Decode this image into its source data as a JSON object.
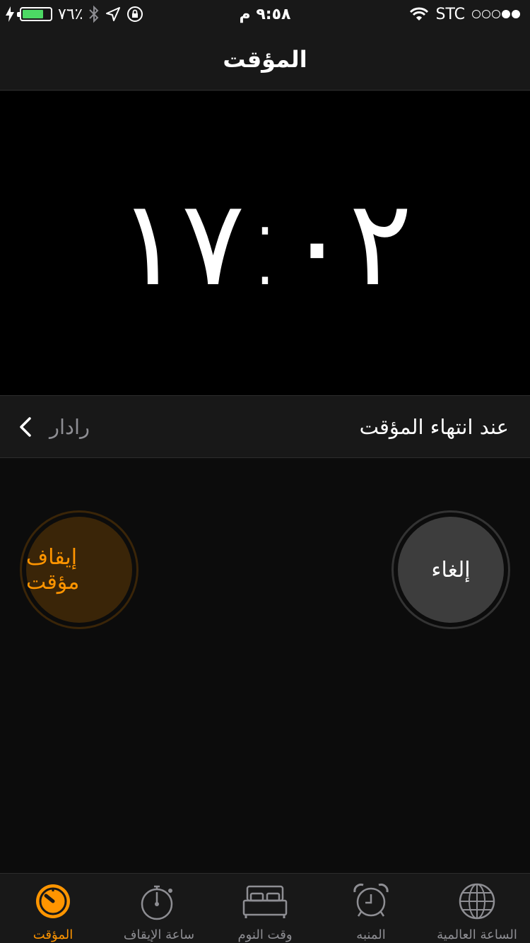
{
  "status_bar": {
    "time": "٩:٥٨ م",
    "battery_percent": "٧٦٪",
    "battery_level": 0.76,
    "carrier": "STC",
    "signal_bars": 2
  },
  "nav": {
    "title": "المؤقت"
  },
  "timer": {
    "remaining": "١٧:٠٢"
  },
  "end_row": {
    "label": "عند انتهاء المؤقت",
    "value": "رادار"
  },
  "buttons": {
    "pause_label": "إيقاف مؤقت",
    "cancel_label": "إلغاء"
  },
  "tabs": [
    {
      "label": "المؤقت",
      "icon": "timer-icon",
      "active": true
    },
    {
      "label": "ساعة الإيقاف",
      "icon": "stopwatch-icon",
      "active": false
    },
    {
      "label": "وقت النوم",
      "icon": "bed-icon",
      "active": false
    },
    {
      "label": "المنبه",
      "icon": "alarm-clock-icon",
      "active": false
    },
    {
      "label": "الساعة العالمية",
      "icon": "globe-icon",
      "active": false
    }
  ],
  "colors": {
    "accent": "#ff9500",
    "background": "#0c0c0c",
    "bar": "#181818",
    "secondary_text": "#8e8e93"
  }
}
